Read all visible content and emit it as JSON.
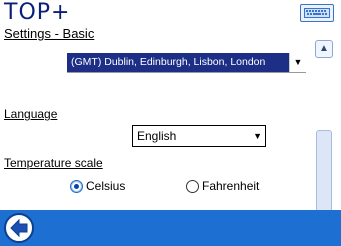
{
  "app": {
    "logo": "TOP+",
    "subtitle": "Settings - Basic"
  },
  "timezone": {
    "value": "(GMT) Dublin, Edinburgh, Lisbon, London"
  },
  "language": {
    "label": "Language",
    "value": "English"
  },
  "temperature": {
    "label": "Temperature scale",
    "options": [
      "Celsius",
      "Fahrenheit"
    ],
    "selected": "Celsius"
  },
  "icons": {
    "keyboard": "keyboard-icon",
    "back": "back-arrow-icon",
    "scroll_up": "chevron-up-icon",
    "scroll_down": "chevron-down-icon"
  },
  "colors": {
    "footer": "#1d6fd1",
    "timezone_bg": "#1c2e86",
    "logo": "#0a1f7a"
  }
}
